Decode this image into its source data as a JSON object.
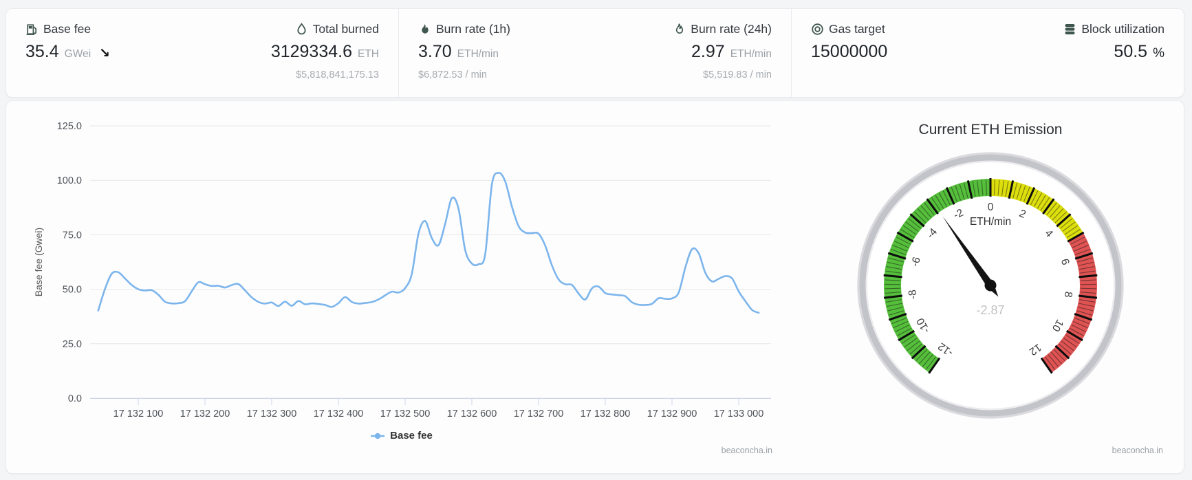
{
  "colors": {
    "line_series": "#7cb5ec",
    "gauge_green": "#55BF3B",
    "gauge_yellow": "#DDDF0D",
    "gauge_red": "#DF5353",
    "icon": "#3f564d",
    "grid": "#e8e8e8",
    "axis": "#ccd6eb",
    "tick_text": "#4d5257",
    "muted_text": "#9aa0a5"
  },
  "stats": {
    "items": [
      {
        "icon": "fuel-pump-icon",
        "label": "Base fee",
        "value": "35.4",
        "unit": "GWei",
        "trend_glyph": "↘"
      },
      {
        "icon": "water-drop-icon",
        "label": "Total burned",
        "value": "3129334.6",
        "unit": "ETH",
        "sub": "$5,818,841,175.13"
      },
      {
        "icon": "flame-icon",
        "label": "Burn rate (1h)",
        "value": "3.70",
        "unit": "ETH/min",
        "sub": "$6,872.53 / min"
      },
      {
        "icon": "flame-icon",
        "label": "Burn rate (24h)",
        "value": "2.97",
        "unit": "ETH/min",
        "sub": "$5,519.83 / min"
      },
      {
        "icon": "target-icon",
        "label": "Gas target",
        "value": "15000000"
      },
      {
        "icon": "stack-icon",
        "label": "Block utilization",
        "value": "50.5",
        "unit": "%"
      }
    ]
  },
  "chart_data": [
    {
      "type": "line",
      "title": "",
      "ylabel": "Base fee (Gwei)",
      "xlabel": "",
      "grid": "horizontal",
      "legend_position": "bottom",
      "ylim": [
        0,
        125
      ],
      "yticks": [
        0,
        25,
        50,
        75,
        100,
        125
      ],
      "xticks": [
        17132100,
        17132200,
        17132300,
        17132400,
        17132500,
        17132600,
        17132700,
        17132800,
        17132900,
        17133000
      ],
      "xtick_labels": [
        "17 132 100",
        "17 132 200",
        "17 132 300",
        "17 132 400",
        "17 132 500",
        "17 132 600",
        "17 132 700",
        "17 132 800",
        "17 132 900",
        "17 133 000"
      ],
      "series": [
        {
          "name": "Base fee",
          "color": "#7cb5ec",
          "x_start": 17132040,
          "x_step": 10,
          "values": [
            40.2,
            50.0,
            57.0,
            57.8,
            55.0,
            52.0,
            50.0,
            49.4,
            49.6,
            47.5,
            44.3,
            43.5,
            43.6,
            44.5,
            49.0,
            53.2,
            52.3,
            51.5,
            51.6,
            50.8,
            51.9,
            52.4,
            49.5,
            46.3,
            44.2,
            43.4,
            43.9,
            42.3,
            44.3,
            42.4,
            44.6,
            43.1,
            43.5,
            43.2,
            42.8,
            41.9,
            43.6,
            46.4,
            44.2,
            43.4,
            43.7,
            44.1,
            45.3,
            47.2,
            48.9,
            48.5,
            50.5,
            57.0,
            75.5,
            81.3,
            73.5,
            70.2,
            80.0,
            91.8,
            87.0,
            68.0,
            61.8,
            61.5,
            66.0,
            98.0,
            103.4,
            99.5,
            88.0,
            79.0,
            76.0,
            75.8,
            75.5,
            70.0,
            61.0,
            54.5,
            52.3,
            52.0,
            48.0,
            45.3,
            50.4,
            51.2,
            48.2,
            47.6,
            47.3,
            46.8,
            44.0,
            42.9,
            42.8,
            43.3,
            45.9,
            45.6,
            45.8,
            48.5,
            60.0,
            68.4,
            66.5,
            57.5,
            53.6,
            54.8,
            56.0,
            55.0,
            49.0,
            44.5,
            40.5,
            39.2
          ]
        }
      ],
      "watermark": "beaconcha.in"
    },
    {
      "type": "gauge",
      "title": "Current ETH Emission",
      "unit_label": "ETH/min",
      "value": -2.87,
      "value_display": "-2.87",
      "min": -12,
      "max": 12,
      "start_angle": -145,
      "end_angle": 145,
      "label_step": 2,
      "major_tick_step": 1,
      "minor_tick_step": 0.2,
      "bands": [
        {
          "from": -12,
          "to": 0,
          "color": "#55BF3B"
        },
        {
          "from": 0,
          "to": 5,
          "color": "#DDDF0D"
        },
        {
          "from": 5,
          "to": 12,
          "color": "#DF5353"
        }
      ],
      "watermark": "beaconcha.in"
    }
  ]
}
